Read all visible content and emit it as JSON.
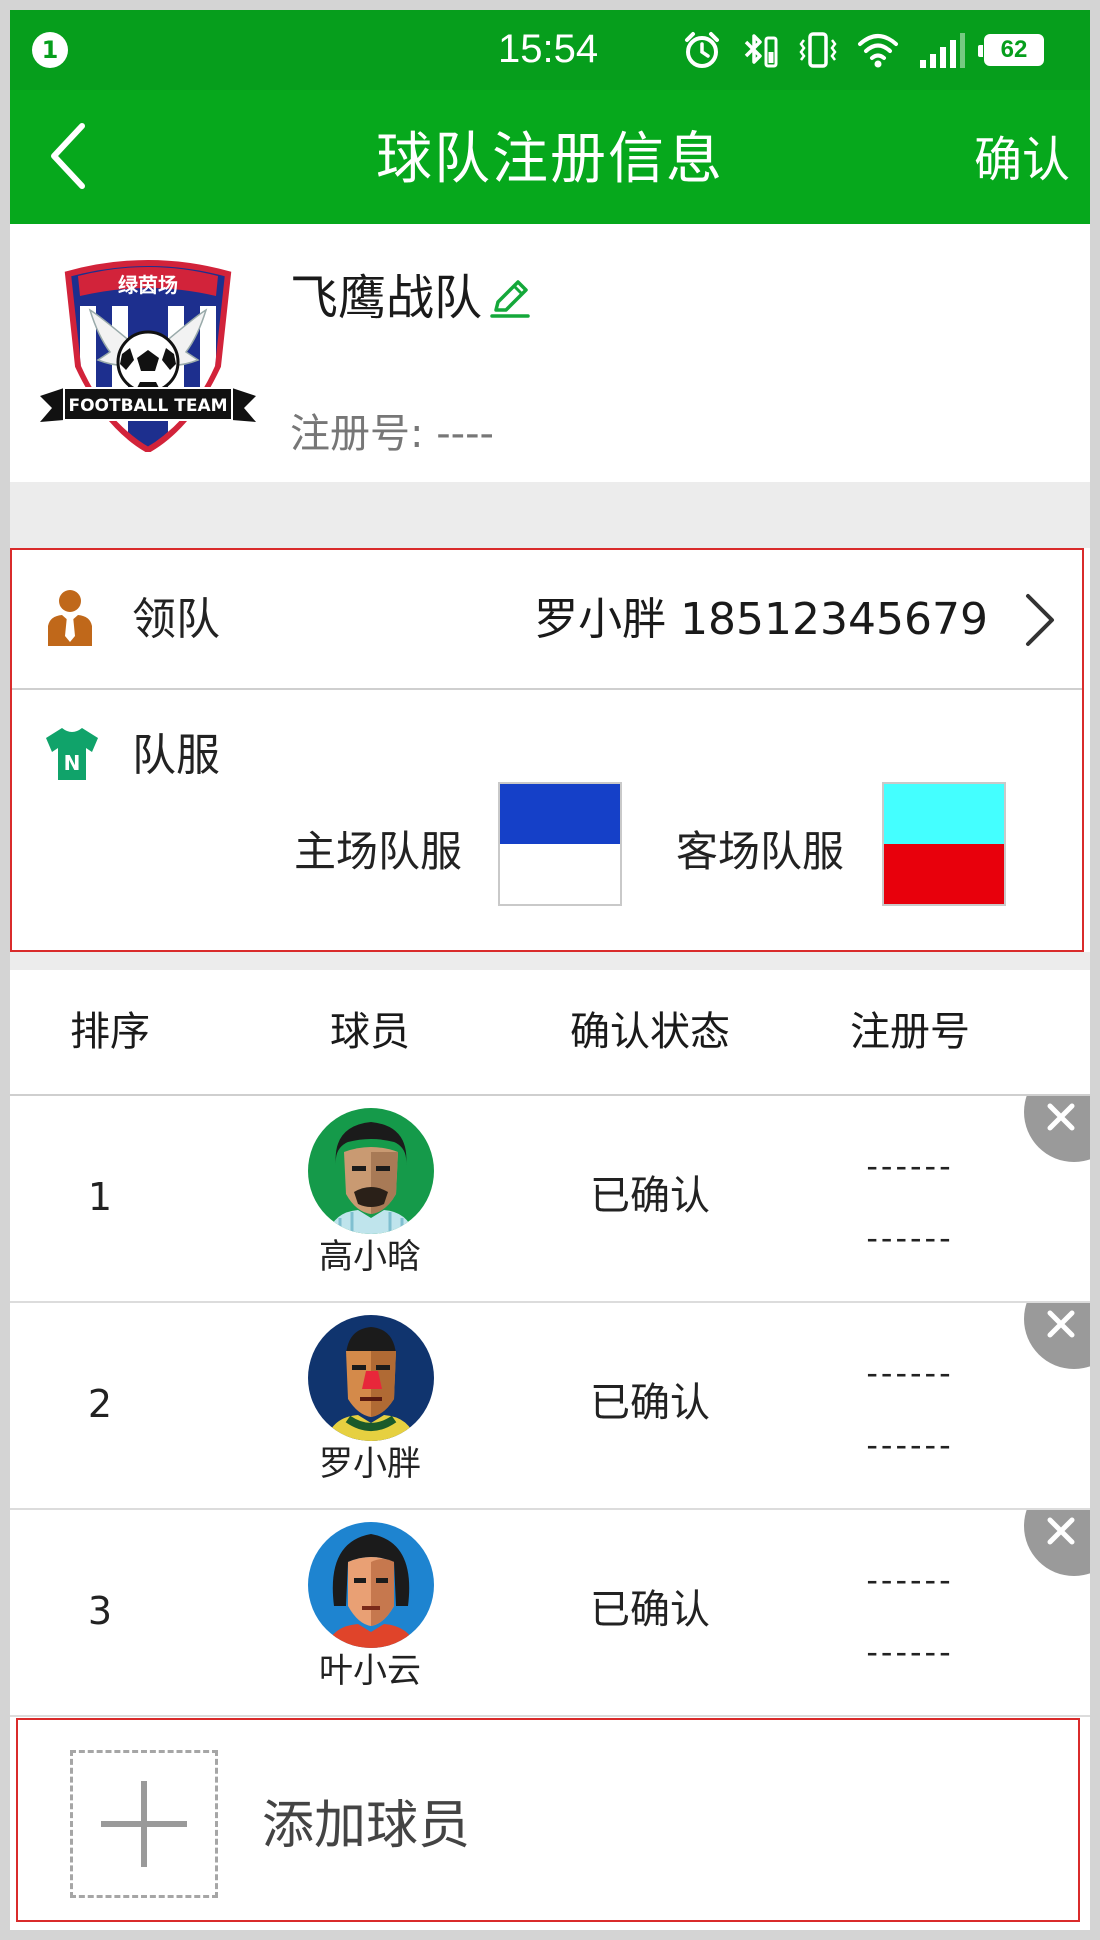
{
  "status_bar": {
    "notification_count": "1",
    "time": "15:54",
    "battery": "62",
    "icons": [
      "alarm-icon",
      "bluetooth-icon",
      "vibrate-icon",
      "wifi-icon",
      "signal-icon",
      "battery-icon"
    ]
  },
  "nav": {
    "title": "球队注册信息",
    "confirm_label": "确认",
    "back_icon": "chevron-left-icon"
  },
  "team": {
    "name": "飞鹰战队",
    "reg_label": "注册号:",
    "reg_value": "----",
    "logo": {
      "banner_text": "绿茵场",
      "ribbon_text": "FOOTBALL TEAM"
    }
  },
  "leader": {
    "label": "领队",
    "value": "罗小胖 18512345679"
  },
  "uniform": {
    "label": "队服",
    "home_label": "主场队服",
    "away_label": "客场队服",
    "home_colors": {
      "top": "#1540c8",
      "bottom": "#ffffff"
    },
    "away_colors": {
      "top": "#44ffff",
      "bottom": "#e8000c"
    }
  },
  "table": {
    "headers": [
      "排序",
      "球员",
      "确认状态",
      "注册号"
    ],
    "rows": [
      {
        "rank": "1",
        "name": "高小晗",
        "status": "已确认",
        "reg_line1": "------",
        "reg_line2": "------"
      },
      {
        "rank": "2",
        "name": "罗小胖",
        "status": "已确认",
        "reg_line1": "------",
        "reg_line2": "------"
      },
      {
        "rank": "3",
        "name": "叶小云",
        "status": "已确认",
        "reg_line1": "------",
        "reg_line2": "------"
      }
    ]
  },
  "add_player": {
    "label": "添加球员"
  },
  "colors": {
    "primary_green": "#06a81c",
    "status_green": "#069e1c",
    "highlight_red": "#d92b2b"
  }
}
